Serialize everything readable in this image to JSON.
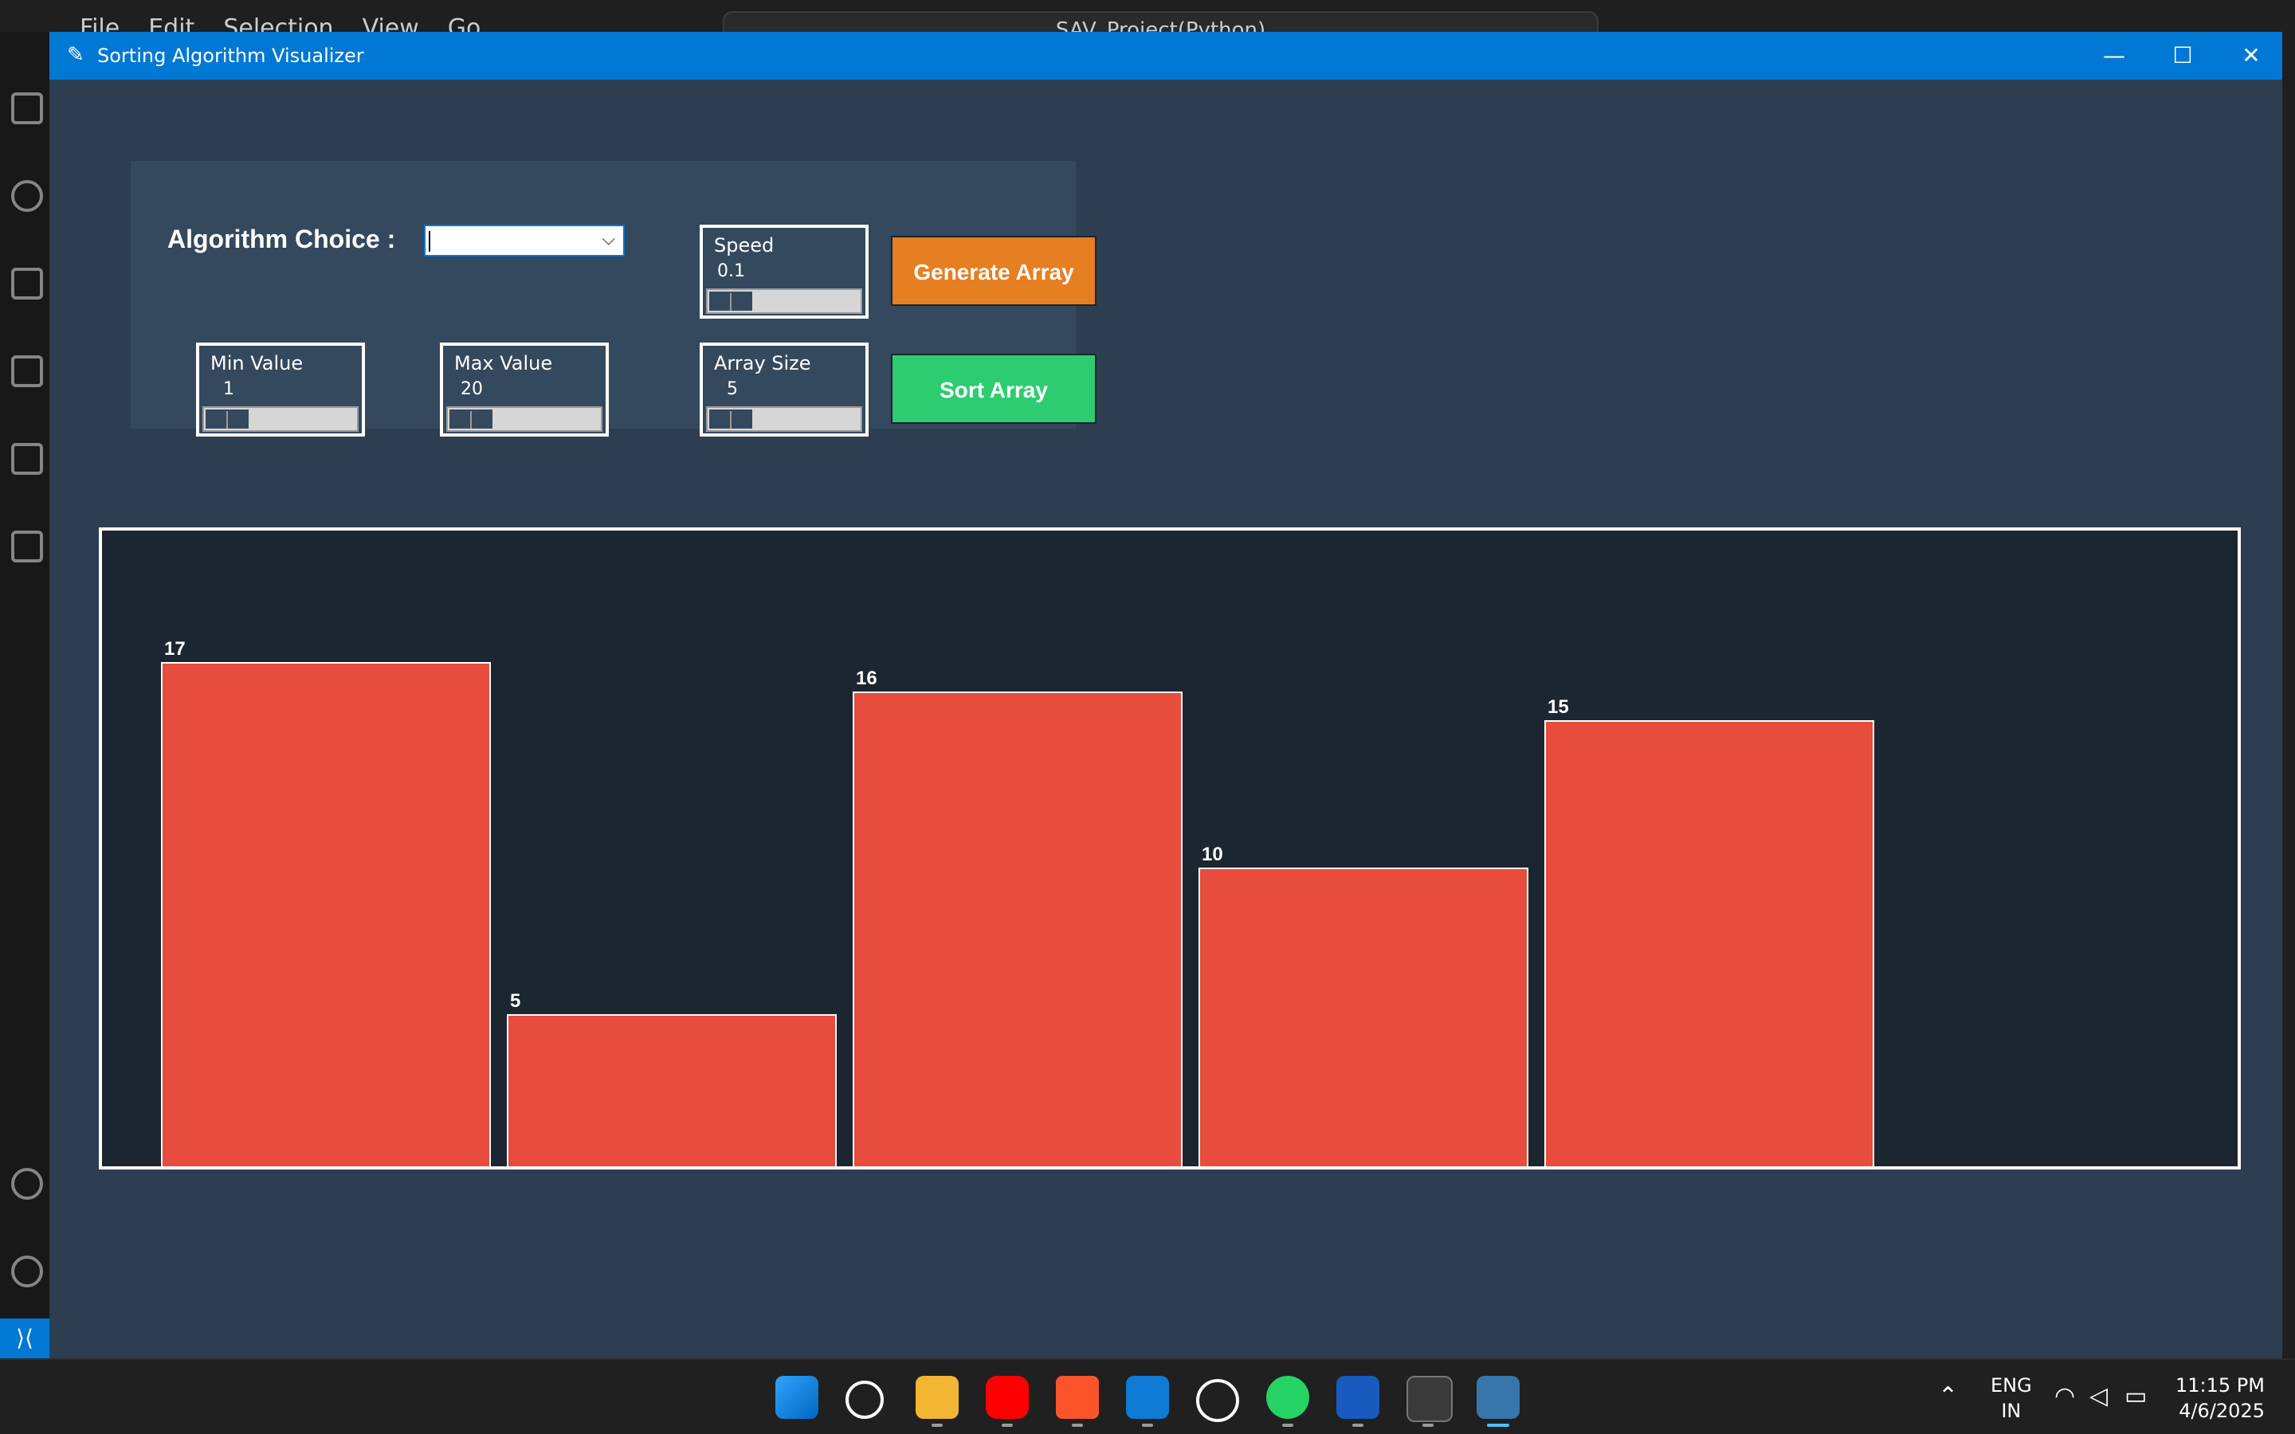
{
  "vscode": {
    "menu": [
      "File",
      "Edit",
      "Selection",
      "View",
      "Go",
      "..."
    ],
    "search_text": "SAV_Project(Python)"
  },
  "window": {
    "title": "Sorting Algorithm Visualizer",
    "controls": {
      "minimize": "—",
      "maximize": "☐",
      "close": "✕"
    }
  },
  "controls": {
    "algorithm_label": "Algorithm Choice :",
    "algorithm_value": "",
    "speed": {
      "label": "Speed",
      "value": "0.1"
    },
    "min_value": {
      "label": "Min Value",
      "value": "1"
    },
    "max_value": {
      "label": "Max Value",
      "value": "20"
    },
    "array_size": {
      "label": "Array Size",
      "value": "5"
    },
    "generate_label": "Generate Array",
    "sort_label": "Sort Array"
  },
  "chart_data": {
    "type": "bar",
    "values": [
      17,
      5,
      16,
      10,
      15
    ],
    "bar_color": "#e74c3c",
    "background": "#1b2631"
  },
  "colors": {
    "window_bg": "#2c3e50",
    "panel_bg": "#34495e",
    "titlebar": "#0078d4",
    "generate": "#e67e22",
    "sort": "#2ecc71"
  },
  "taskbar": {
    "apps": [
      "windows-start",
      "search",
      "file-explorer",
      "youtube",
      "brave",
      "vscode",
      "chatgpt",
      "whatsapp",
      "word",
      "terminal",
      "python"
    ],
    "lang_line1": "ENG",
    "lang_line2": "IN",
    "time": "11:15 PM",
    "date": "4/6/2025"
  }
}
